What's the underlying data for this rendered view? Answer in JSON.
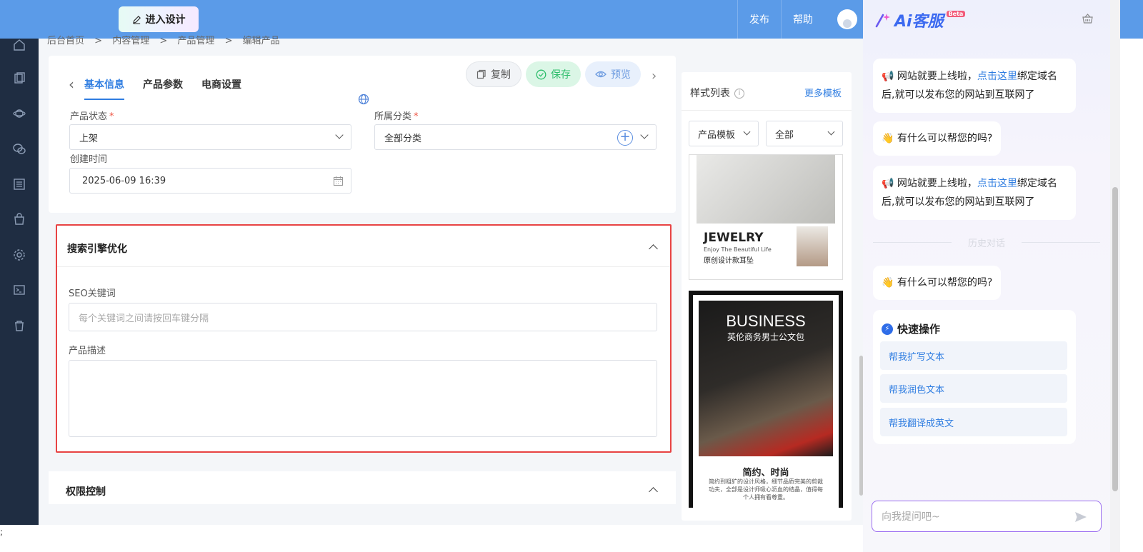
{
  "topbar": {
    "design_button": "进入设计",
    "publish": "发布",
    "help": "帮助"
  },
  "breadcrumb": [
    "后台首页",
    ">",
    "内容管理",
    ">",
    "产品管理",
    ">",
    "编辑产品"
  ],
  "tabs": {
    "items": [
      "基本信息",
      "产品参数",
      "电商设置"
    ],
    "copy": "复制",
    "save": "保存",
    "preview": "预览"
  },
  "form": {
    "status_label": "产品状态",
    "status_value": "上架",
    "category_label": "所属分类",
    "category_value": "全部分类",
    "created_label": "创建时间",
    "created_value": "2025-06-09 16:39",
    "required_mark": "*"
  },
  "seo": {
    "title": "搜索引擎优化",
    "keywords_label": "SEO关键词",
    "keywords_placeholder": "每个关键词之间请按回车键分隔",
    "desc_label": "产品描述"
  },
  "permission": {
    "title": "权限控制"
  },
  "style_list": {
    "title": "样式列表",
    "more": "更多模板",
    "filter_type": "产品模板",
    "filter_all": "全部",
    "info_glyph": "i",
    "thumb1": {
      "title": "JEWELRY",
      "subtitle": "Enjoy The Beautiful Life",
      "cn": "原创设计款耳坠"
    },
    "thumb2": {
      "title": "BUSINESS",
      "cn": "英伦商务男士公文包",
      "slogan": "简约、时尚",
      "desc": "简约到粗犷的设计风格，细节品质完美的剪裁功夫，全部是设计师吸心沥血的结晶，值得每个人拥有看尊重。"
    }
  },
  "ai": {
    "logo": "Ai客服",
    "beta": "Beta",
    "msg1_a": "网站就要上线啦，",
    "msg1_link": "点击这里",
    "msg1_b": "绑定域名后,就可以发布您的网站到互联网了",
    "msg2": "有什么可以帮您的吗?",
    "history": "历史对话",
    "quick_title": "快速操作",
    "quick_items": [
      "帮我扩写文本",
      "帮我润色文本",
      "帮我翻译成英文"
    ],
    "input_placeholder": "向我提问吧~"
  },
  "footer_char": ";",
  "colors": {
    "topbar": "#5b9be8",
    "sidebar": "#1f2d42",
    "accent": "#2f7de1",
    "highlight_border": "#e84343",
    "save_green": "#2dbd6b"
  }
}
